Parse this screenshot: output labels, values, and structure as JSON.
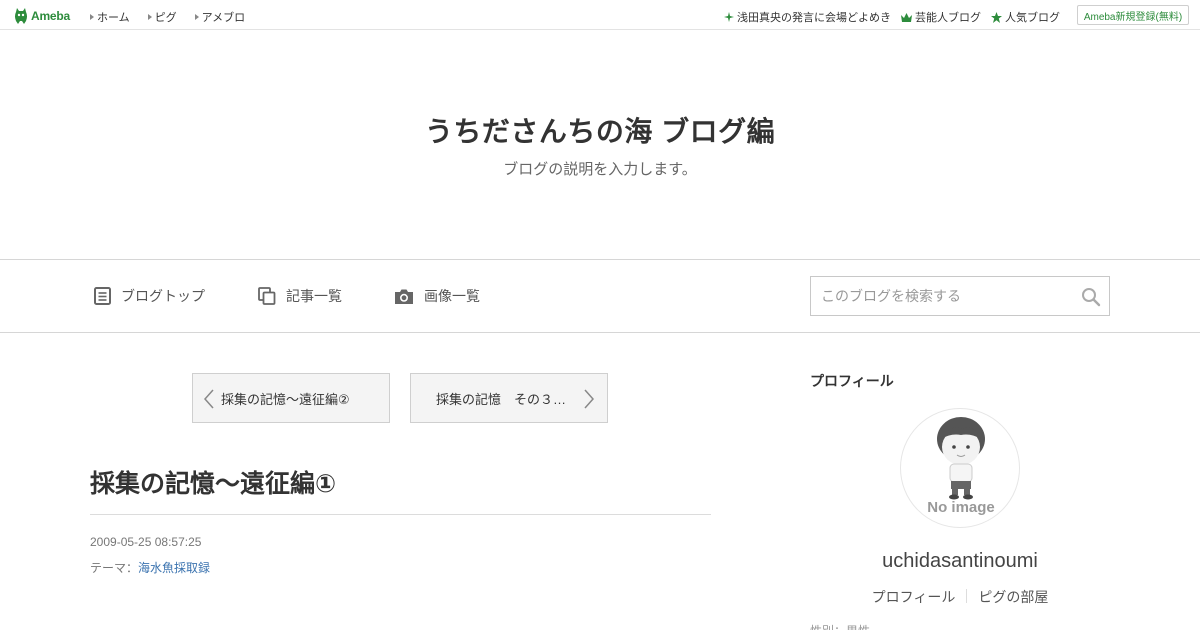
{
  "topbar": {
    "logo_text": "Ameba",
    "nav": [
      "ホーム",
      "ピグ",
      "アメブロ"
    ],
    "links": [
      {
        "label": "浅田真央の発言に会場どよめき",
        "icon": "sparkle-icon"
      },
      {
        "label": "芸能人ブログ",
        "icon": "crown-icon"
      },
      {
        "label": "人気ブログ",
        "icon": "star-icon"
      }
    ],
    "register": "Ameba新規登録(無料)",
    "accent": "#2d8c3c"
  },
  "header": {
    "title": "うちださんちの海 ブログ編",
    "description": "ブログの説明を入力します。"
  },
  "nav": {
    "items": [
      {
        "label": "ブログトップ",
        "icon": "document-icon"
      },
      {
        "label": "記事一覧",
        "icon": "copy-icon"
      },
      {
        "label": "画像一覧",
        "icon": "camera-icon"
      }
    ],
    "search_placeholder": "このブログを検索する"
  },
  "pager": {
    "prev": "採集の記憶～遠征編②",
    "next": "採集の記憶　その３…"
  },
  "article": {
    "title": "採集の記憶～遠征編①",
    "date": "2009-05-25 08:57:25",
    "theme_label": "テーマ：",
    "theme": "海水魚採取録"
  },
  "sidebar": {
    "heading": "プロフィール",
    "avatar_text": "No image",
    "username": "uchidasantinoumi",
    "links": [
      "プロフィール",
      "ピグの部屋"
    ],
    "cut_text": "性別：男性"
  }
}
